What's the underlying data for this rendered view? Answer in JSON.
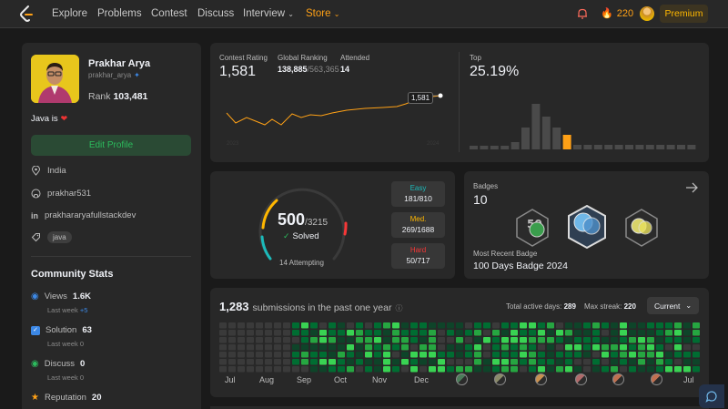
{
  "nav": {
    "items": [
      "Explore",
      "Problems",
      "Contest",
      "Discuss",
      "Interview",
      "Store"
    ],
    "streak": "220",
    "premium": "Premium"
  },
  "profile": {
    "name": "Prakhar Arya",
    "handle": "prakhar_arya",
    "rank_label": "Rank",
    "rank_value": "103,481",
    "bio": "Java is",
    "edit_button": "Edit Profile",
    "location": "India",
    "github": "prakhar531",
    "linkedin": "prakhararyafullstackdev",
    "skill_tag": "java"
  },
  "community": {
    "title": "Community Stats",
    "stats": [
      {
        "label": "Views",
        "value": "1.6K",
        "sub": "Last week",
        "delta": "+5",
        "icon": "eye-icon"
      },
      {
        "label": "Solution",
        "value": "63",
        "sub": "Last week",
        "delta": "0",
        "icon": "solution-icon"
      },
      {
        "label": "Discuss",
        "value": "0",
        "sub": "Last week",
        "delta": "0",
        "icon": "discuss-icon"
      },
      {
        "label": "Reputation",
        "value": "20",
        "icon": "star-icon"
      }
    ]
  },
  "contest": {
    "rating_label": "Contest Rating",
    "rating": "1,581",
    "global_label": "Global Ranking",
    "global_rank": "138,885",
    "global_total": "/563,365",
    "attended_label": "Attended",
    "attended": "14",
    "top_label": "Top",
    "top_value": "25.19%",
    "tooltip": "1,581",
    "year_start": "2023",
    "year_end": "2024"
  },
  "solved": {
    "count": "500",
    "total": "/3215",
    "solved_label": "Solved",
    "attempting": "14 Attempting",
    "easy_label": "Easy",
    "easy_value": "181/810",
    "medium_label": "Med.",
    "medium_value": "269/1688",
    "hard_label": "Hard",
    "hard_value": "50/717"
  },
  "badges": {
    "label": "Badges",
    "count": "10",
    "recent_label": "Most Recent Badge",
    "recent_name": "100 Days Badge 2024"
  },
  "submissions": {
    "count": "1,283",
    "text": "submissions in the past one year",
    "active_label": "Total active days:",
    "active_value": "289",
    "streak_label": "Max streak:",
    "streak_value": "220",
    "selector": "Current",
    "months": [
      "Jul",
      "Aug",
      "Sep",
      "Oct",
      "Nov",
      "Dec",
      "Jul"
    ]
  },
  "colors": {
    "accent": "#ffa116",
    "easy": "#1cbaba",
    "medium": "#ffb700",
    "hard": "#f63737",
    "green": "#2cbb5d"
  }
}
